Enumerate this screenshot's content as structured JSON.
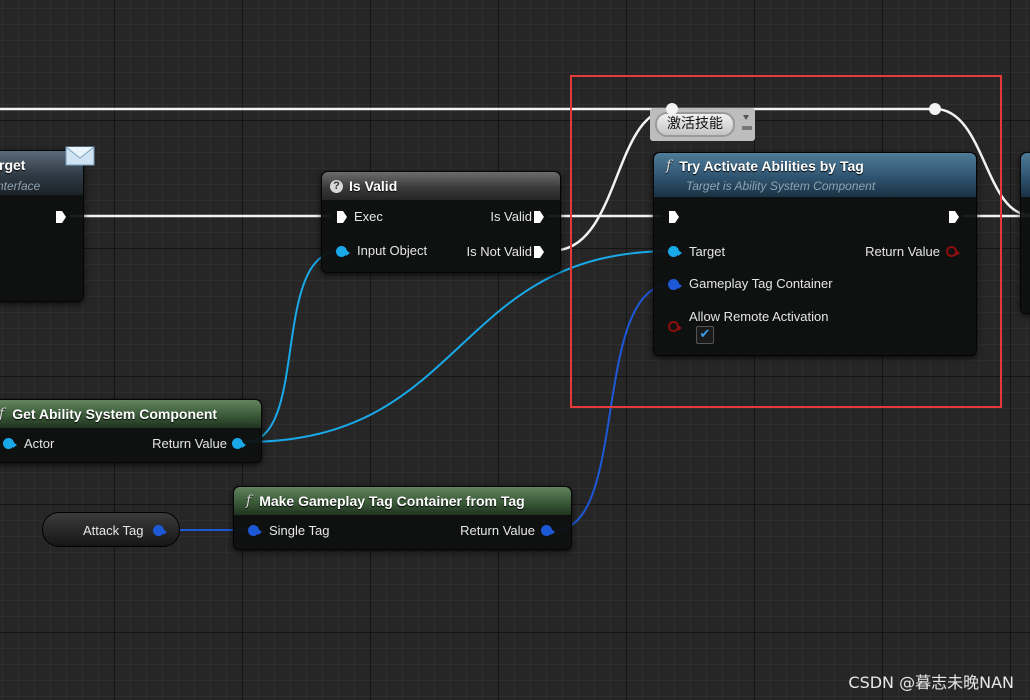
{
  "nodes": {
    "left_node": {
      "title": "rget",
      "subtitle": "nterface"
    },
    "is_valid": {
      "title": "Is Valid",
      "exec_in": "Exec",
      "input_object": "Input Object",
      "is_valid_out": "Is Valid",
      "is_not_valid_out": "Is Not Valid"
    },
    "try_activate": {
      "title": "Try Activate Abilities by Tag",
      "subtitle": "Target is Ability System Component",
      "target": "Target",
      "return_value": "Return Value",
      "tag_container": "Gameplay Tag Container",
      "allow_remote": "Allow Remote Activation",
      "allow_remote_checked": "✔"
    },
    "get_asc": {
      "title": "Get Ability System Component",
      "actor": "Actor",
      "return_value": "Return Value"
    },
    "make_tag_container": {
      "title": "Make Gameplay Tag Container from Tag",
      "single_tag": "Single Tag",
      "return_value": "Return Value"
    },
    "attack_tag": {
      "label": "Attack Tag"
    }
  },
  "comment_bubble": {
    "text": "激活技能"
  },
  "watermark": "CSDN @暮志未晚NAN",
  "colors": {
    "exec_wire": "#ffffff",
    "object_wire": "#19a9e8",
    "struct_wire": "#1d59d6",
    "bool_pin": "#8d0e0e",
    "selection": "#e43a3a"
  },
  "icons": {
    "function": "function-f-icon",
    "mail": "envelope-icon",
    "question": "question-icon",
    "check": "checkmark-icon"
  }
}
